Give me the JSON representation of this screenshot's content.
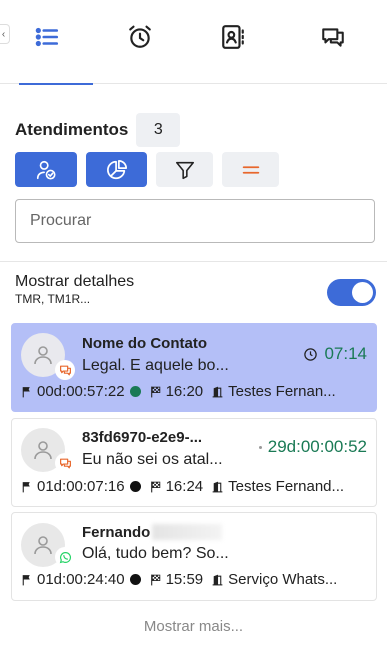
{
  "tabs": [
    {
      "icon": "list-icon",
      "active": true
    },
    {
      "icon": "alarm-clock-icon",
      "active": false
    },
    {
      "icon": "contacts-book-icon",
      "active": false
    },
    {
      "icon": "chat-bubbles-icon",
      "active": false
    }
  ],
  "header": {
    "title": "Atendimentos",
    "count": "3"
  },
  "filters": [
    {
      "icon": "user-check-icon",
      "style": "blue"
    },
    {
      "icon": "pie-chart-icon",
      "style": "blue"
    },
    {
      "icon": "funnel-icon",
      "style": "grey"
    },
    {
      "icon": "equals-icon",
      "style": "grey"
    }
  ],
  "search": {
    "placeholder": "Procurar",
    "value": ""
  },
  "details": {
    "label": "Mostrar detalhes",
    "sub": "TMR, TM1R...",
    "toggle_on": true
  },
  "colors": {
    "accent": "#3d6bd8",
    "selected_bg": "#b4bff7",
    "time_green": "#1a7a55",
    "status_green": "#1a7a55",
    "status_black": "#111111",
    "chat_orange": "#e8672c",
    "whatsapp_green": "#25d366"
  },
  "cards": [
    {
      "name": "Nome do Contato",
      "message": "Legal. E aquele bo...",
      "time": "07:14",
      "time_icon": "clock-icon",
      "channel": "chat-icon",
      "duration": "00d:00:57:22",
      "status_color": "#1a7a55",
      "finish_time": "16:20",
      "queue": "Testes Fernan...",
      "selected": true
    },
    {
      "name": "83fd6970-e2e9-...",
      "message": "Eu não sei os atal...",
      "time": "29d:00:00:52",
      "time_icon": "small-dot",
      "channel": "chat-icon",
      "duration": "01d:00:07:16",
      "status_color": "#111111",
      "finish_time": "16:24",
      "queue": "Testes Fernand...",
      "selected": false
    },
    {
      "name": "Fernando",
      "message": "Olá, tudo bem? So...",
      "time": "",
      "time_icon": "",
      "channel": "whatsapp-icon",
      "duration": "01d:00:24:40",
      "status_color": "#111111",
      "finish_time": "15:59",
      "queue": "Serviço Whats...",
      "selected": false
    }
  ],
  "more_label": "Mostrar mais..."
}
